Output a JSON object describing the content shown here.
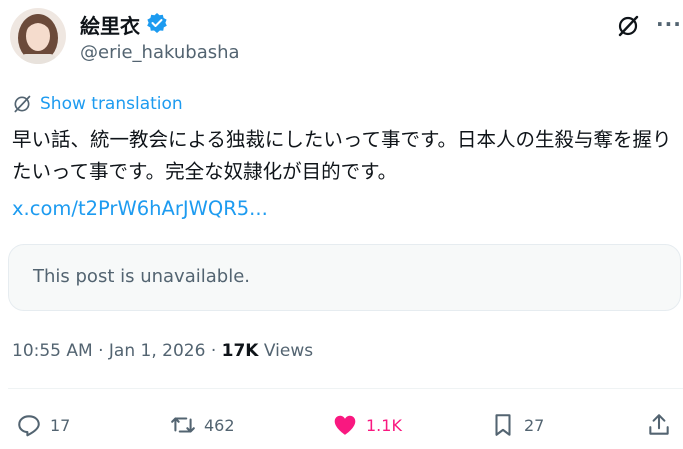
{
  "author": {
    "display_name": "絵里衣",
    "handle": "@erie_hakubasha",
    "verified": true
  },
  "translate_label": "Show translation",
  "post": {
    "text": "早い話、統一教会による独裁にしたいって事です。日本人の生殺与奪を握りたいって事です。完全な奴隷化が目的です。",
    "link": "x.com/t2PrW6hArJWQR5..."
  },
  "quote": {
    "unavailable_text": "This post is unavailable."
  },
  "meta": {
    "time": "10:55 AM",
    "date": "Jan 1, 2026",
    "views_count": "17K",
    "views_label": "Views"
  },
  "actions": {
    "replies": "17",
    "reposts": "462",
    "likes": "1.1K",
    "bookmarks": "27"
  },
  "colors": {
    "accent": "#1d9bf0",
    "like": "#f91880",
    "muted": "#536471",
    "text": "#0f1419"
  },
  "icons": [
    "verified-badge-icon",
    "grok-icon",
    "more-icon",
    "translate-icon",
    "reply-icon",
    "repost-icon",
    "like-icon",
    "bookmark-icon",
    "share-icon"
  ]
}
